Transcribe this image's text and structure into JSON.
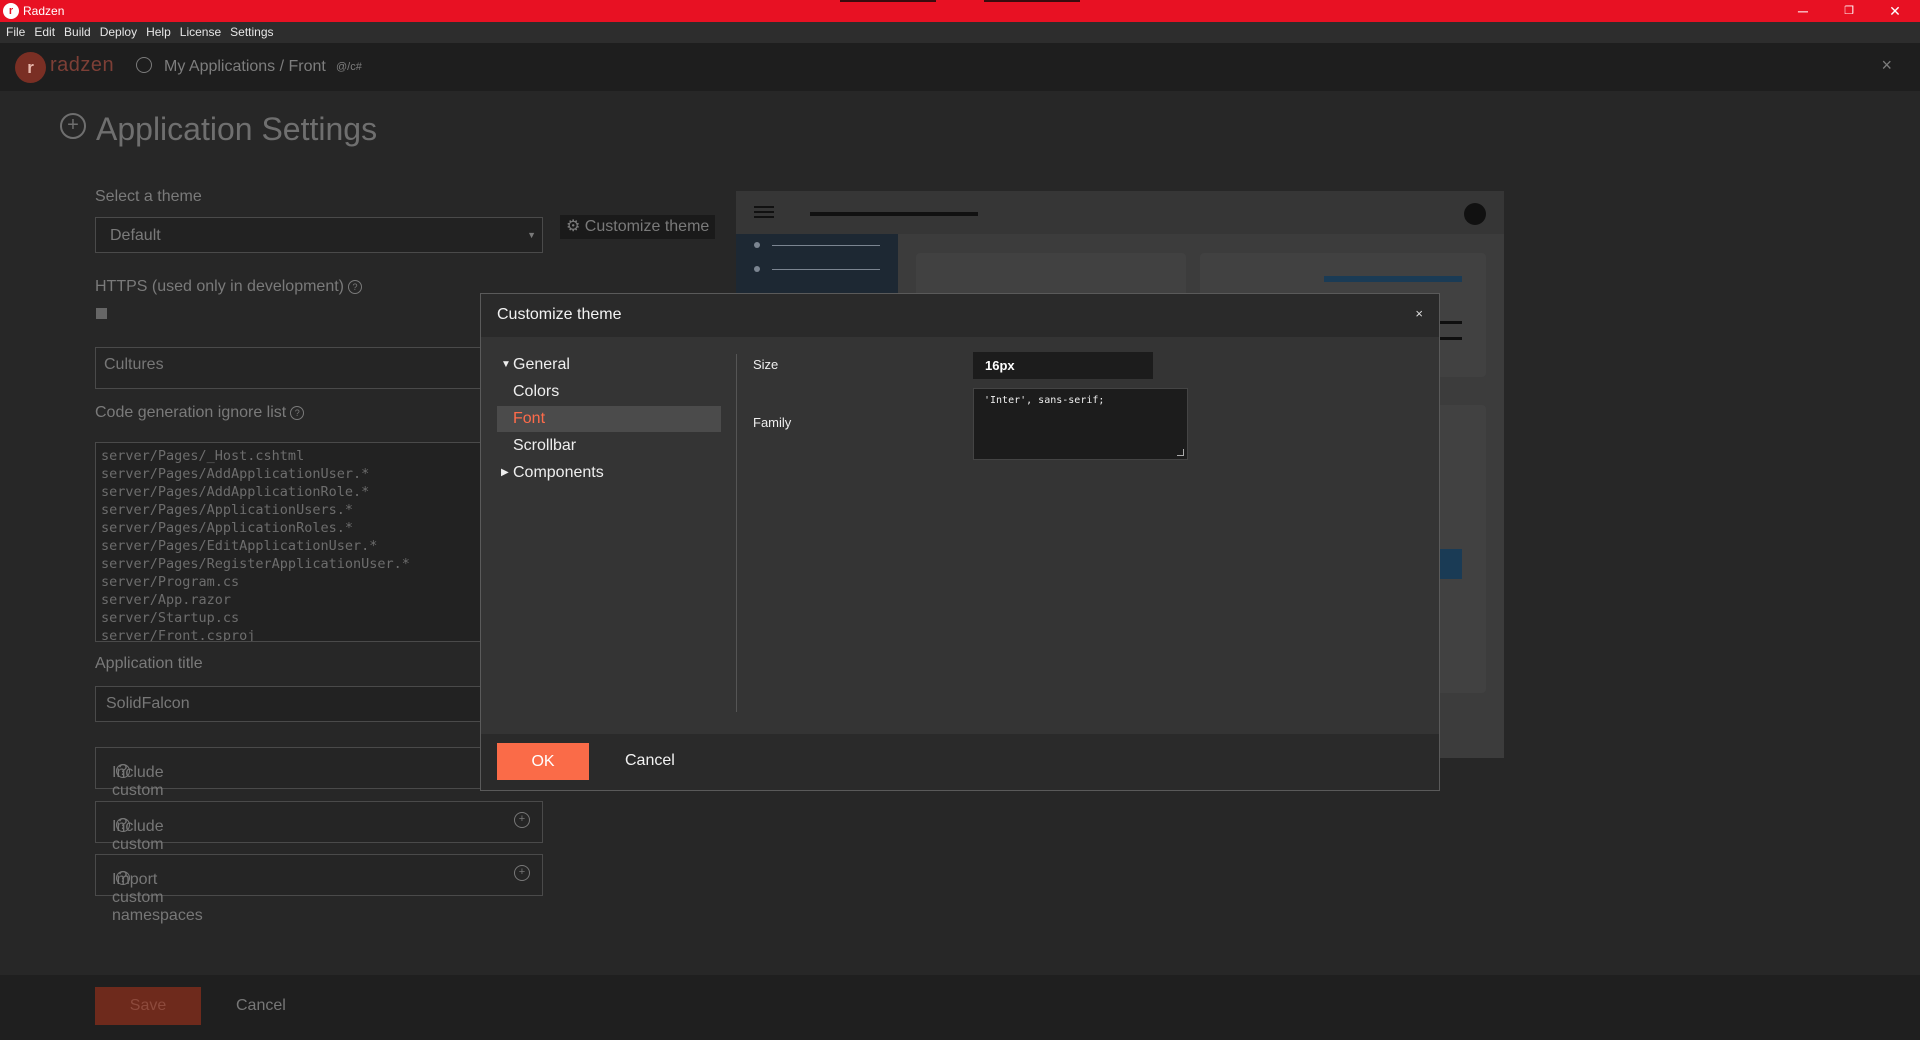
{
  "window": {
    "title": "Radzen",
    "logo_glyph": "r",
    "controls": {
      "minimize": "─",
      "restore": "❐",
      "close": "✕"
    },
    "accent": "#e81123"
  },
  "menu": [
    "File",
    "Edit",
    "Build",
    "Deploy",
    "Help",
    "License",
    "Settings"
  ],
  "header": {
    "brand_glyph": "r",
    "brand_text": "radzen",
    "breadcrumb": "My Applications / Front",
    "breadcrumb_tag": "@/c#",
    "close": "×"
  },
  "page": {
    "title": "Application Settings",
    "theme_label": "Select a theme",
    "theme_value": "Default",
    "customize_theme_button": "Customize theme",
    "https_label": "HTTPS (used only in development)",
    "cultures_label": "Cultures",
    "ignore_list_label": "Code generation ignore list",
    "ignore_list": [
      "server/Pages/_Host.cshtml",
      "server/Pages/AddApplicationUser.*",
      "server/Pages/AddApplicationRole.*",
      "server/Pages/ApplicationUsers.*",
      "server/Pages/ApplicationRoles.*",
      "server/Pages/EditApplicationUser.*",
      "server/Pages/RegisterApplicationUser.*",
      "server/Program.cs",
      "server/App.razor",
      "server/Startup.cs",
      "server/Front.csproj"
    ],
    "app_title_label": "Application title",
    "app_title_value": "SolidFalcon",
    "custom_js_label": "Include custom JavaScript files",
    "custom_css_label": "Include custom CSS files",
    "namespaces_label": "Import custom namespaces",
    "save_button": "Save",
    "cancel_button": "Cancel"
  },
  "modal": {
    "title": "Customize theme",
    "close": "×",
    "tree": [
      {
        "label": "General",
        "expanded": true
      },
      {
        "label": "Colors"
      },
      {
        "label": "Font",
        "selected": true
      },
      {
        "label": "Scrollbar"
      },
      {
        "label": "Components",
        "expanded": false
      }
    ],
    "size_label": "Size",
    "size_value": "16px",
    "family_label": "Family",
    "family_value": "'Inter', sans-serif;",
    "ok_button": "OK",
    "cancel_button": "Cancel",
    "accent": "#fa6b48"
  }
}
